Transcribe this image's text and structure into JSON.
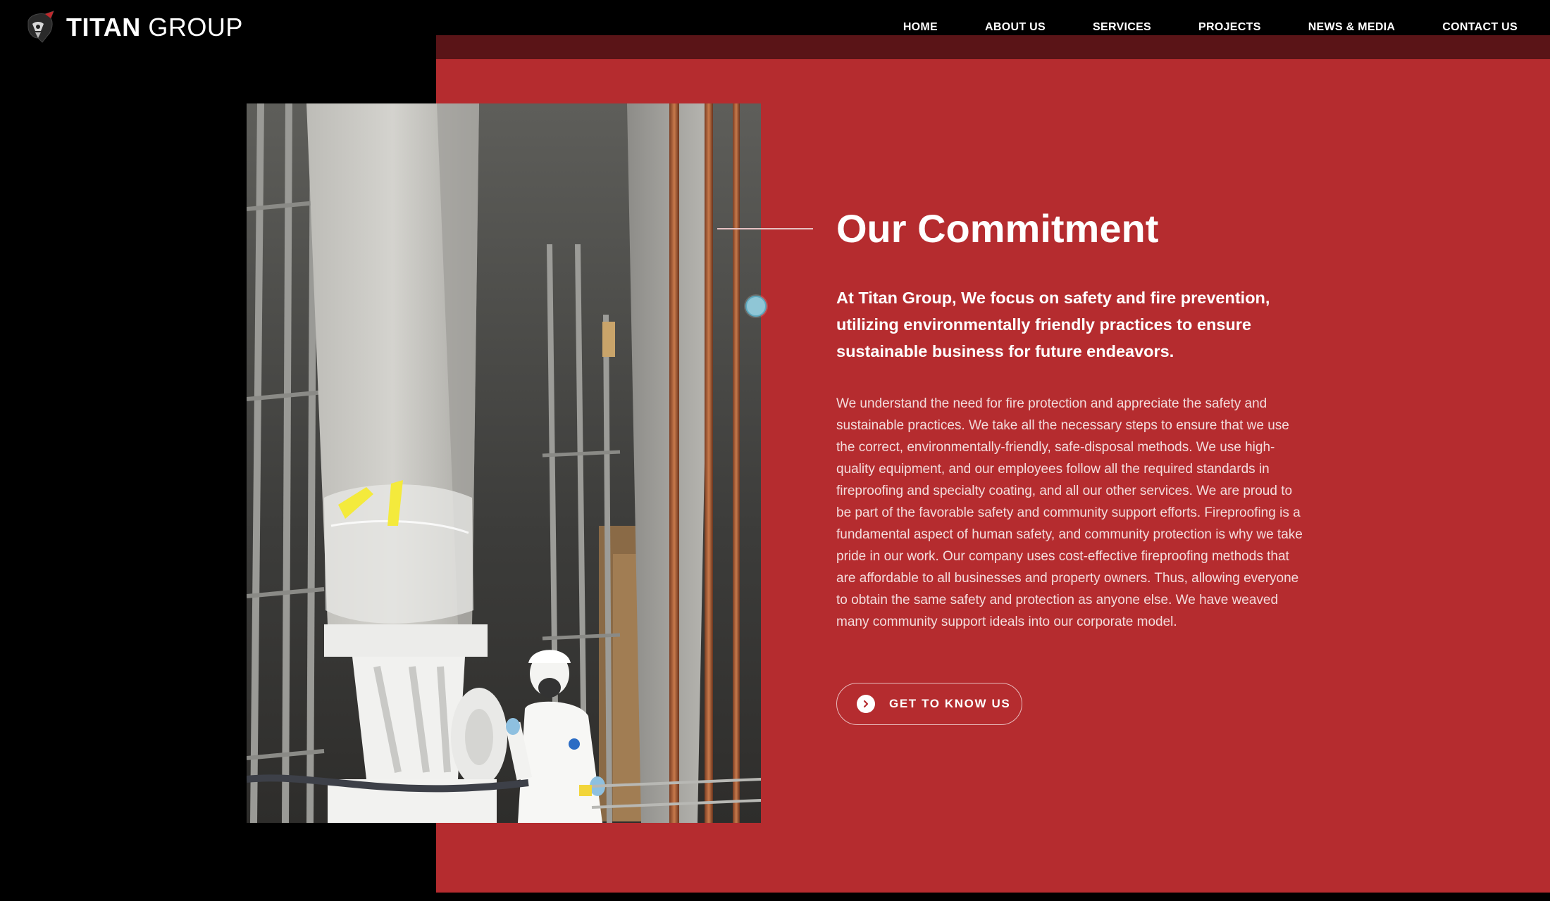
{
  "brand": {
    "name_bold": "TITAN",
    "name_light": "GROUP",
    "logo_icon": "warrior-helmet-icon"
  },
  "nav": {
    "items": [
      {
        "label": "HOME"
      },
      {
        "label": "ABOUT US"
      },
      {
        "label": "SERVICES"
      },
      {
        "label": "PROJECTS"
      },
      {
        "label": "NEWS & MEDIA"
      },
      {
        "label": "CONTACT US"
      }
    ]
  },
  "section": {
    "title": "Our Commitment",
    "lead": "At Titan Group, We focus on safety and fire prevention, utilizing environmentally friendly practices to ensure sustainable business for future endeavors.",
    "body": "We understand the need for fire protection and appreciate the safety and sustainable practices. We take all the necessary steps to ensure that we use the correct, environmentally-friendly, safe-disposal methods. We use high-quality equipment, and our employees follow all the required standards in fireproofing and specialty coating, and all our other services. We are proud to be part of the favorable safety and community support efforts. Fireproofing is a fundamental aspect of human safety, and community protection is why we take pride in our work. Our company uses cost-effective fireproofing methods that are affordable to all businesses and property owners. Thus, allowing everyone to obtain the same safety and protection as anyone else. We have weaved many community support ideals into our corporate model.",
    "cta_label": "GET TO KNOW US",
    "cta_icon": "chevron-right-circle-icon"
  },
  "colors": {
    "accent_red": "#b52c2f",
    "dark_red_band": "#5a1417",
    "background": "#000000"
  }
}
